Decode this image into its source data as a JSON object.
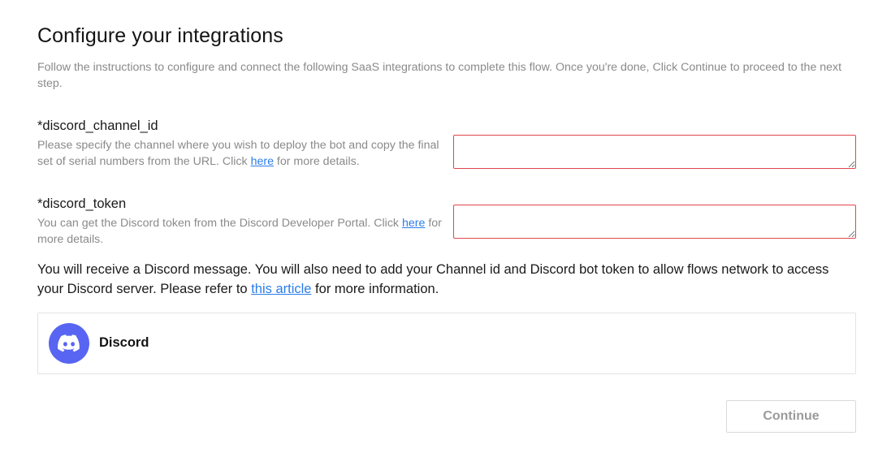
{
  "page": {
    "title": "Configure your integrations",
    "subtitle": "Follow the instructions to configure and connect the following SaaS integrations to complete this flow. Once you're done, Click Continue to proceed to the next step."
  },
  "fields": [
    {
      "label": "*discord_channel_id",
      "desc_before": "Please specify the channel where you wish to deploy the bot and copy the final set of serial numbers from the URL. Click ",
      "link": "here",
      "desc_after": " for more details.",
      "value": ""
    },
    {
      "label": "*discord_token",
      "desc_before": "You can get the Discord token from the Discord Developer Portal. Click ",
      "link": "here",
      "desc_after": " for more details.",
      "value": ""
    }
  ],
  "notice": {
    "before": "You will receive a Discord message. You will also need to add your Channel id and Discord bot token to allow flows network to access your Discord server. Please refer to ",
    "link": "this article",
    "after": " for more information."
  },
  "integration": {
    "name": "Discord",
    "icon": "discord-icon",
    "brand_color": "#5865f2"
  },
  "actions": {
    "continue_label": "Continue"
  },
  "colors": {
    "error_border": "#e0474c",
    "link": "#2b7de9",
    "muted_text": "#8a8a8a"
  }
}
